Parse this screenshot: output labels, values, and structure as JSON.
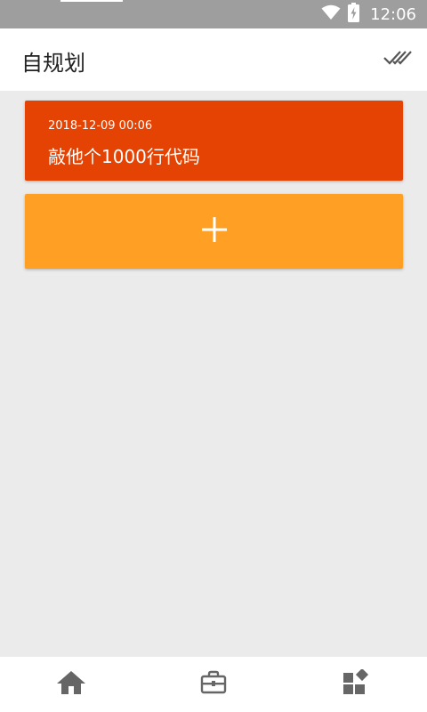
{
  "status_bar": {
    "time": "12:06",
    "icons": [
      "wifi-icon",
      "battery-charging-icon"
    ]
  },
  "app_bar": {
    "title": "自规划",
    "action_icon": "double-check-icon"
  },
  "tasks": [
    {
      "time": "2018-12-09 00:06",
      "title": "敲他个1000行代码",
      "color": "#e44303"
    }
  ],
  "add_card": {
    "icon": "plus-icon",
    "color": "#ffa024"
  },
  "bottom_nav": {
    "items": [
      {
        "icon": "home-icon"
      },
      {
        "icon": "briefcase-icon"
      },
      {
        "icon": "widgets-icon"
      }
    ]
  }
}
